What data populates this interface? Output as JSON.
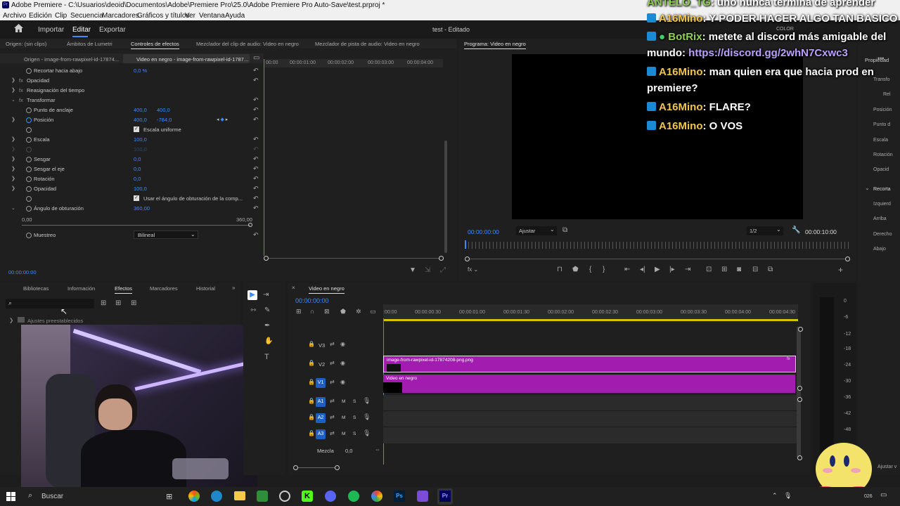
{
  "app": {
    "title": "Adobe Premiere - C:\\Usuarios\\deoid\\Documentos\\Adobe\\Premiere Pro\\25.0\\Adobe Premiere Pro Auto-Save\\test.prproj *"
  },
  "menu": [
    "Archivo",
    "Edición",
    "Clip",
    "Secuencia",
    "Marcadores",
    "Gráficos y títulos",
    "Ver",
    "Ventana",
    "Ayuda"
  ],
  "workspace": {
    "import": "Importar",
    "edit": "Editar",
    "export": "Exportar",
    "project_title": "test - Editado"
  },
  "source_tabs": [
    "Origen: (sin clips)",
    "Ámbitos de Lumetri",
    "Controles de efectos",
    "Mezclador del clip de audio: Video en negro",
    "Mezclador de pista de audio: Video en negro"
  ],
  "effect_controls": {
    "clip_tabs": [
      "Origen - image-from-rawpixel-id-17874...",
      "Video en negro - image-from-rawpixel-id-1787..."
    ],
    "ruler": [
      "00:00",
      "00:00:01:00",
      "00:00:02:00",
      "00:00:03:00",
      "00:00:04:00"
    ],
    "rows": [
      {
        "label": "Recortar hacia abajo",
        "v1": "0,0 %",
        "v2": ""
      },
      {
        "label": "Opacidad",
        "v1": "",
        "v2": ""
      },
      {
        "label": "Reasignación del tiempo",
        "v1": "",
        "v2": ""
      },
      {
        "label": "Transformar",
        "v1": "",
        "v2": ""
      },
      {
        "label": "Punto de anclaje",
        "v1": "400,0",
        "v2": "400,0"
      },
      {
        "label": "Posición",
        "v1": "400,0",
        "v2": "-784,0"
      },
      {
        "label": "Escala uniforme",
        "v1": "",
        "v2": ""
      },
      {
        "label": "Escala",
        "v1": "100,0",
        "v2": ""
      },
      {
        "label": "",
        "v1": "100,0",
        "v2": ""
      },
      {
        "label": "Sesgar",
        "v1": "0,0",
        "v2": ""
      },
      {
        "label": "Sesgar el eje",
        "v1": "0,0",
        "v2": ""
      },
      {
        "label": "Rotación",
        "v1": "0,0",
        "v2": ""
      },
      {
        "label": "Opacidad",
        "v1": "100,0",
        "v2": ""
      },
      {
        "label": "Usar el ángulo de obturación de la comp...",
        "v1": "",
        "v2": ""
      },
      {
        "label": "Ángulo de obturación",
        "v1": "360,00",
        "v2": ""
      }
    ],
    "range_min": "0,00",
    "range_max": "360,00",
    "sampling_label": "Muestreo",
    "sampling_value": "Bilineal",
    "timecode": "00:00:00:00"
  },
  "program": {
    "tab": "Programa: Video en negro",
    "timecode": "00:00:00:00",
    "fit": "Ajustar",
    "quality": "1/2",
    "duration": "00:00:10:00"
  },
  "effects_panel": {
    "tabs": [
      "Bibliotecas",
      "Información",
      "Efectos",
      "Marcadores",
      "Historial"
    ],
    "search_placeholder": "",
    "tree_item": "Ajustes preestablecidos"
  },
  "timeline": {
    "tab": "Video en negro",
    "timecode": "00:00:00:00",
    "ruler": [
      ":00:00",
      "00:00:00:30",
      "00:00:01:00",
      "00:00:01:30",
      "00:00:02:00",
      "00:00:02:30",
      "00:00:03:00",
      "00:00:03:30",
      "00:00:04:00",
      "00:00:04:30"
    ],
    "tracks": [
      "V3",
      "V2",
      "V1",
      "A1",
      "A2",
      "A3"
    ],
    "mix_label": "Mezcla",
    "mix_value": "0,0",
    "clip_v2": "image-from-rawpixel-id-17874208-png.png",
    "clip_v1": "Video en negro",
    "m": "M",
    "s": "S"
  },
  "meters": [
    "0",
    "-6",
    "-12",
    "-18",
    "-24",
    "-30",
    "-36",
    "-42",
    "-48"
  ],
  "right_panel": {
    "title": "Propiedad",
    "color_tab": "COLOR",
    "items": [
      "Transfo",
      "Rel",
      "Posición",
      "Punto d",
      "Escala",
      "Rotación",
      "Opacid",
      "Recorta",
      "Izquierd",
      "Arriba",
      "Derecho",
      "Abajo"
    ],
    "fit": "Ajustar v"
  },
  "chat": [
    {
      "name": "ANTELO_TG",
      "text": ": uno nunca termina de aprender"
    },
    {
      "name": "A16Mino",
      "text": ": Y PODER HACER ALGO TAN BASICO"
    },
    {
      "name": "BotRix",
      "text": ": metete al discord más amigable del mundo: ",
      "link": "https://discord.gg/2whN7Cxwc3"
    },
    {
      "name": "A16Mino",
      "text": ": man quien era que hacia prod en premiere?"
    },
    {
      "name": "A16Mino",
      "text": ": FLARE?"
    },
    {
      "name": "A16Mino",
      "text": ": O VOS"
    }
  ],
  "taskbar": {
    "search": "Buscar",
    "time": "026"
  },
  "colors": {
    "accent": "#3b8cff",
    "clip": "#a21caf",
    "chat_name": "#f2c64a"
  }
}
